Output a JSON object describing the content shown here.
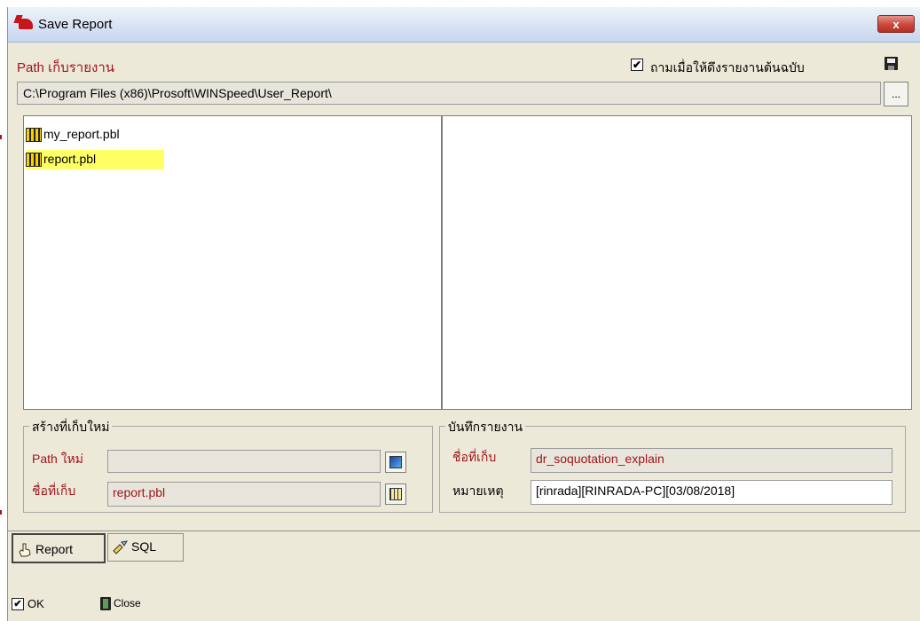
{
  "window": {
    "title": "Save Report",
    "close_glyph": "x",
    "accent": "#c4161c"
  },
  "path_section": {
    "label": "Path เก็บรายงาน",
    "checkbox_label": "ถามเมื่อให้ดึงรายงานต้นฉบับ",
    "checkbox_checked": true,
    "checkbox_glyph": "✔",
    "path_value": "C:\\Program Files (x86)\\Prosoft\\WINSpeed\\User_Report\\",
    "browse_label": "...",
    "save_icon": "floppy-disk-icon"
  },
  "files": [
    {
      "name": "my_report.pbl",
      "selected": false,
      "icon": "library-icon"
    },
    {
      "name": "report.pbl",
      "selected": true,
      "icon": "library-icon"
    }
  ],
  "new_library": {
    "title": "สร้างที่เก็บใหม่",
    "path_label": "Path ใหม่",
    "path_value": "",
    "name_label": "ชื่อที่เก็บ",
    "name_value": "report.pbl",
    "browse_icon": "picture-browse-icon",
    "grid_icon": "library-grid-icon"
  },
  "save_report": {
    "title": "บันทึกรายงาน",
    "name_label": "ชื่อที่เก็บ",
    "name_value": "dr_soquotation_explain",
    "note_label": "หมายเหตุ",
    "note_value": "[rinrada][RINRADA-PC][03/08/2018]"
  },
  "tabs": [
    {
      "label": "Report",
      "active": true,
      "icon": "hand-pointer-icon"
    },
    {
      "label": "SQL",
      "active": false,
      "icon": "brush-icon"
    }
  ],
  "footer": {
    "ok_label": "OK",
    "close_label": "Close",
    "ok_glyph": "✔"
  }
}
